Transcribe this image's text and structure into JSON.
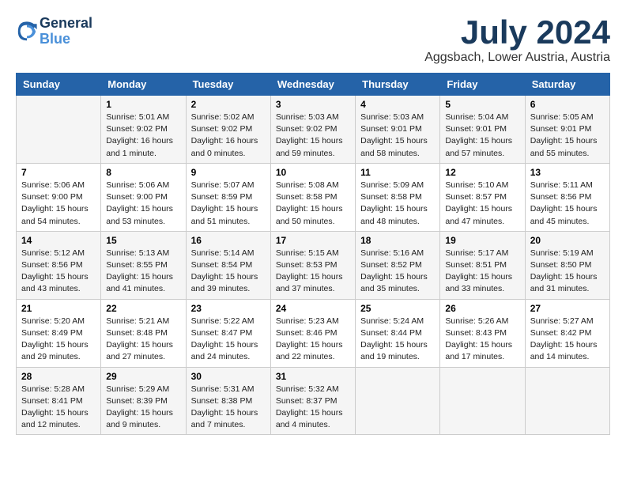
{
  "logo": {
    "line1": "General",
    "line2": "Blue"
  },
  "title": "July 2024",
  "location": "Aggsbach, Lower Austria, Austria",
  "days_of_week": [
    "Sunday",
    "Monday",
    "Tuesday",
    "Wednesday",
    "Thursday",
    "Friday",
    "Saturday"
  ],
  "weeks": [
    [
      {
        "num": "",
        "sunrise": "",
        "sunset": "",
        "daylight": ""
      },
      {
        "num": "1",
        "sunrise": "Sunrise: 5:01 AM",
        "sunset": "Sunset: 9:02 PM",
        "daylight": "Daylight: 16 hours and 1 minute."
      },
      {
        "num": "2",
        "sunrise": "Sunrise: 5:02 AM",
        "sunset": "Sunset: 9:02 PM",
        "daylight": "Daylight: 16 hours and 0 minutes."
      },
      {
        "num": "3",
        "sunrise": "Sunrise: 5:03 AM",
        "sunset": "Sunset: 9:02 PM",
        "daylight": "Daylight: 15 hours and 59 minutes."
      },
      {
        "num": "4",
        "sunrise": "Sunrise: 5:03 AM",
        "sunset": "Sunset: 9:01 PM",
        "daylight": "Daylight: 15 hours and 58 minutes."
      },
      {
        "num": "5",
        "sunrise": "Sunrise: 5:04 AM",
        "sunset": "Sunset: 9:01 PM",
        "daylight": "Daylight: 15 hours and 57 minutes."
      },
      {
        "num": "6",
        "sunrise": "Sunrise: 5:05 AM",
        "sunset": "Sunset: 9:01 PM",
        "daylight": "Daylight: 15 hours and 55 minutes."
      }
    ],
    [
      {
        "num": "7",
        "sunrise": "Sunrise: 5:06 AM",
        "sunset": "Sunset: 9:00 PM",
        "daylight": "Daylight: 15 hours and 54 minutes."
      },
      {
        "num": "8",
        "sunrise": "Sunrise: 5:06 AM",
        "sunset": "Sunset: 9:00 PM",
        "daylight": "Daylight: 15 hours and 53 minutes."
      },
      {
        "num": "9",
        "sunrise": "Sunrise: 5:07 AM",
        "sunset": "Sunset: 8:59 PM",
        "daylight": "Daylight: 15 hours and 51 minutes."
      },
      {
        "num": "10",
        "sunrise": "Sunrise: 5:08 AM",
        "sunset": "Sunset: 8:58 PM",
        "daylight": "Daylight: 15 hours and 50 minutes."
      },
      {
        "num": "11",
        "sunrise": "Sunrise: 5:09 AM",
        "sunset": "Sunset: 8:58 PM",
        "daylight": "Daylight: 15 hours and 48 minutes."
      },
      {
        "num": "12",
        "sunrise": "Sunrise: 5:10 AM",
        "sunset": "Sunset: 8:57 PM",
        "daylight": "Daylight: 15 hours and 47 minutes."
      },
      {
        "num": "13",
        "sunrise": "Sunrise: 5:11 AM",
        "sunset": "Sunset: 8:56 PM",
        "daylight": "Daylight: 15 hours and 45 minutes."
      }
    ],
    [
      {
        "num": "14",
        "sunrise": "Sunrise: 5:12 AM",
        "sunset": "Sunset: 8:56 PM",
        "daylight": "Daylight: 15 hours and 43 minutes."
      },
      {
        "num": "15",
        "sunrise": "Sunrise: 5:13 AM",
        "sunset": "Sunset: 8:55 PM",
        "daylight": "Daylight: 15 hours and 41 minutes."
      },
      {
        "num": "16",
        "sunrise": "Sunrise: 5:14 AM",
        "sunset": "Sunset: 8:54 PM",
        "daylight": "Daylight: 15 hours and 39 minutes."
      },
      {
        "num": "17",
        "sunrise": "Sunrise: 5:15 AM",
        "sunset": "Sunset: 8:53 PM",
        "daylight": "Daylight: 15 hours and 37 minutes."
      },
      {
        "num": "18",
        "sunrise": "Sunrise: 5:16 AM",
        "sunset": "Sunset: 8:52 PM",
        "daylight": "Daylight: 15 hours and 35 minutes."
      },
      {
        "num": "19",
        "sunrise": "Sunrise: 5:17 AM",
        "sunset": "Sunset: 8:51 PM",
        "daylight": "Daylight: 15 hours and 33 minutes."
      },
      {
        "num": "20",
        "sunrise": "Sunrise: 5:19 AM",
        "sunset": "Sunset: 8:50 PM",
        "daylight": "Daylight: 15 hours and 31 minutes."
      }
    ],
    [
      {
        "num": "21",
        "sunrise": "Sunrise: 5:20 AM",
        "sunset": "Sunset: 8:49 PM",
        "daylight": "Daylight: 15 hours and 29 minutes."
      },
      {
        "num": "22",
        "sunrise": "Sunrise: 5:21 AM",
        "sunset": "Sunset: 8:48 PM",
        "daylight": "Daylight: 15 hours and 27 minutes."
      },
      {
        "num": "23",
        "sunrise": "Sunrise: 5:22 AM",
        "sunset": "Sunset: 8:47 PM",
        "daylight": "Daylight: 15 hours and 24 minutes."
      },
      {
        "num": "24",
        "sunrise": "Sunrise: 5:23 AM",
        "sunset": "Sunset: 8:46 PM",
        "daylight": "Daylight: 15 hours and 22 minutes."
      },
      {
        "num": "25",
        "sunrise": "Sunrise: 5:24 AM",
        "sunset": "Sunset: 8:44 PM",
        "daylight": "Daylight: 15 hours and 19 minutes."
      },
      {
        "num": "26",
        "sunrise": "Sunrise: 5:26 AM",
        "sunset": "Sunset: 8:43 PM",
        "daylight": "Daylight: 15 hours and 17 minutes."
      },
      {
        "num": "27",
        "sunrise": "Sunrise: 5:27 AM",
        "sunset": "Sunset: 8:42 PM",
        "daylight": "Daylight: 15 hours and 14 minutes."
      }
    ],
    [
      {
        "num": "28",
        "sunrise": "Sunrise: 5:28 AM",
        "sunset": "Sunset: 8:41 PM",
        "daylight": "Daylight: 15 hours and 12 minutes."
      },
      {
        "num": "29",
        "sunrise": "Sunrise: 5:29 AM",
        "sunset": "Sunset: 8:39 PM",
        "daylight": "Daylight: 15 hours and 9 minutes."
      },
      {
        "num": "30",
        "sunrise": "Sunrise: 5:31 AM",
        "sunset": "Sunset: 8:38 PM",
        "daylight": "Daylight: 15 hours and 7 minutes."
      },
      {
        "num": "31",
        "sunrise": "Sunrise: 5:32 AM",
        "sunset": "Sunset: 8:37 PM",
        "daylight": "Daylight: 15 hours and 4 minutes."
      },
      {
        "num": "",
        "sunrise": "",
        "sunset": "",
        "daylight": ""
      },
      {
        "num": "",
        "sunrise": "",
        "sunset": "",
        "daylight": ""
      },
      {
        "num": "",
        "sunrise": "",
        "sunset": "",
        "daylight": ""
      }
    ]
  ]
}
